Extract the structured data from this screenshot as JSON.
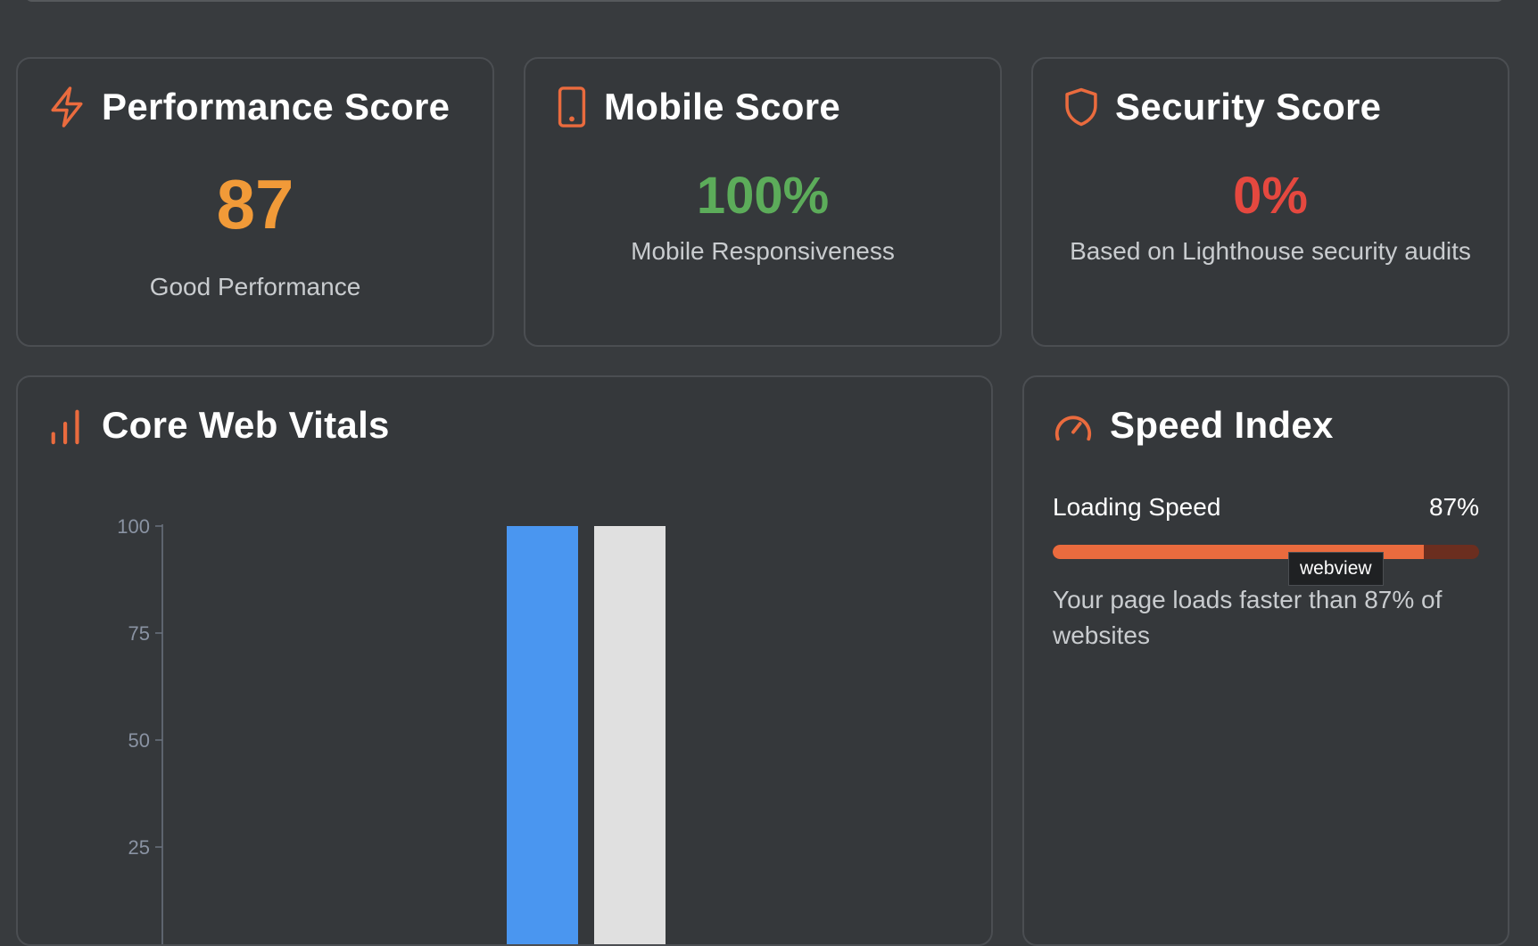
{
  "cards": {
    "performance": {
      "title": "Performance Score",
      "icon": "lightning-icon",
      "value": "87",
      "subtitle": "Good Performance",
      "value_color": "#f19a38"
    },
    "mobile": {
      "title": "Mobile Score",
      "icon": "smartphone-icon",
      "value": "100%",
      "subtitle": "Mobile Responsiveness",
      "value_color": "#5cac5a"
    },
    "security": {
      "title": "Security Score",
      "icon": "shield-icon",
      "value": "0%",
      "subtitle": "Based on Lighthouse security audits",
      "value_color": "#e5483f"
    }
  },
  "vitals": {
    "title": "Core Web Vitals",
    "icon": "bar-chart-icon"
  },
  "speed_index": {
    "title": "Speed Index",
    "icon": "gauge-icon",
    "label": "Loading Speed",
    "value_text": "87%",
    "progress_percent": 87,
    "tooltip": "webview",
    "description": "Your page loads faster than 87% of websites"
  },
  "colors": {
    "accent": "#ea6b3e",
    "background": "#383b3e",
    "card": "#35383b"
  },
  "chart_data": {
    "type": "bar",
    "ylim": [
      0,
      100
    ],
    "y_ticks": [
      100,
      75,
      50,
      25
    ],
    "series": [
      {
        "values": [
          100
        ],
        "color": "#4a96f0"
      },
      {
        "values": [
          100
        ],
        "color": "#e0e0e0"
      }
    ]
  }
}
